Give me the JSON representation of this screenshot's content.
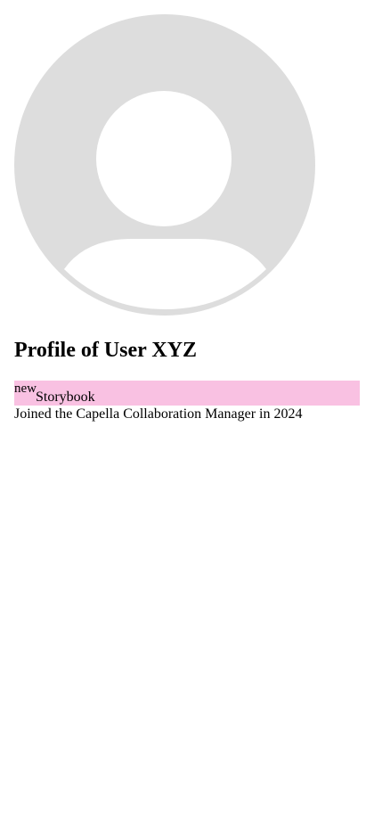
{
  "avatar": {
    "icon": "user-placeholder-icon",
    "background_color": "#dddddd",
    "foreground_color": "#ffffff"
  },
  "profile": {
    "title": "Profile of User XYZ",
    "badge": {
      "superscript": "new",
      "label": "Storybook",
      "color": "#f9c1e2"
    },
    "joined_text": "Joined the Capella Collaboration Manager in 2024"
  }
}
